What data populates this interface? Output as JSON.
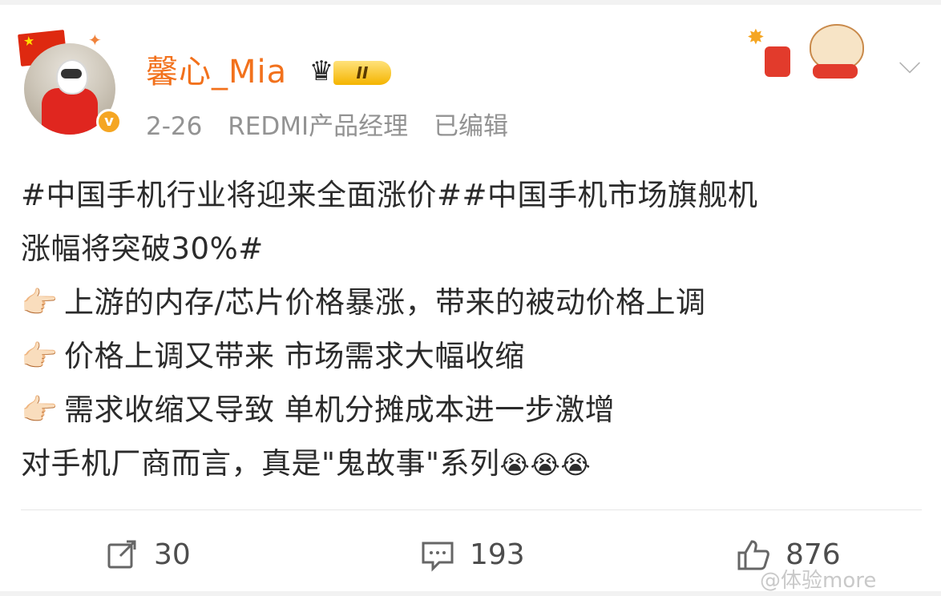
{
  "post": {
    "author": {
      "name": "馨心_Mia",
      "badge_level": "II",
      "verified": true
    },
    "meta": {
      "date": "2-26",
      "title": "REDMI产品经理",
      "edited": "已编辑"
    },
    "content": {
      "hashtag_line1": "#中国手机行业将迎来全面涨价##中国手机市场旗舰机",
      "hashtag_line2": "涨幅将突破30%#",
      "bullets": [
        "上游的内存/芯片价格暴涨，带来的被动价格上调",
        "价格上调又带来 市场需求大幅收缩",
        "需求收缩又导致 单机分摊成本进一步激增"
      ],
      "closing": "对手机厂商而言，真是\"鬼故事\"系列",
      "closing_emoji": "😭😭😭",
      "bullet_emoji": "👉🏻"
    },
    "actions": {
      "reposts": "30",
      "comments": "193",
      "likes": "876"
    }
  },
  "icons": {
    "repost": "repost-icon",
    "comment": "comment-icon",
    "like": "thumbs-up-icon",
    "more": "chevron-down-icon"
  },
  "watermark": "@体验more",
  "colors": {
    "username": "#f2711c",
    "hashtag": "#4a6c9b",
    "meta": "#939393",
    "text": "#2b2b2b"
  }
}
